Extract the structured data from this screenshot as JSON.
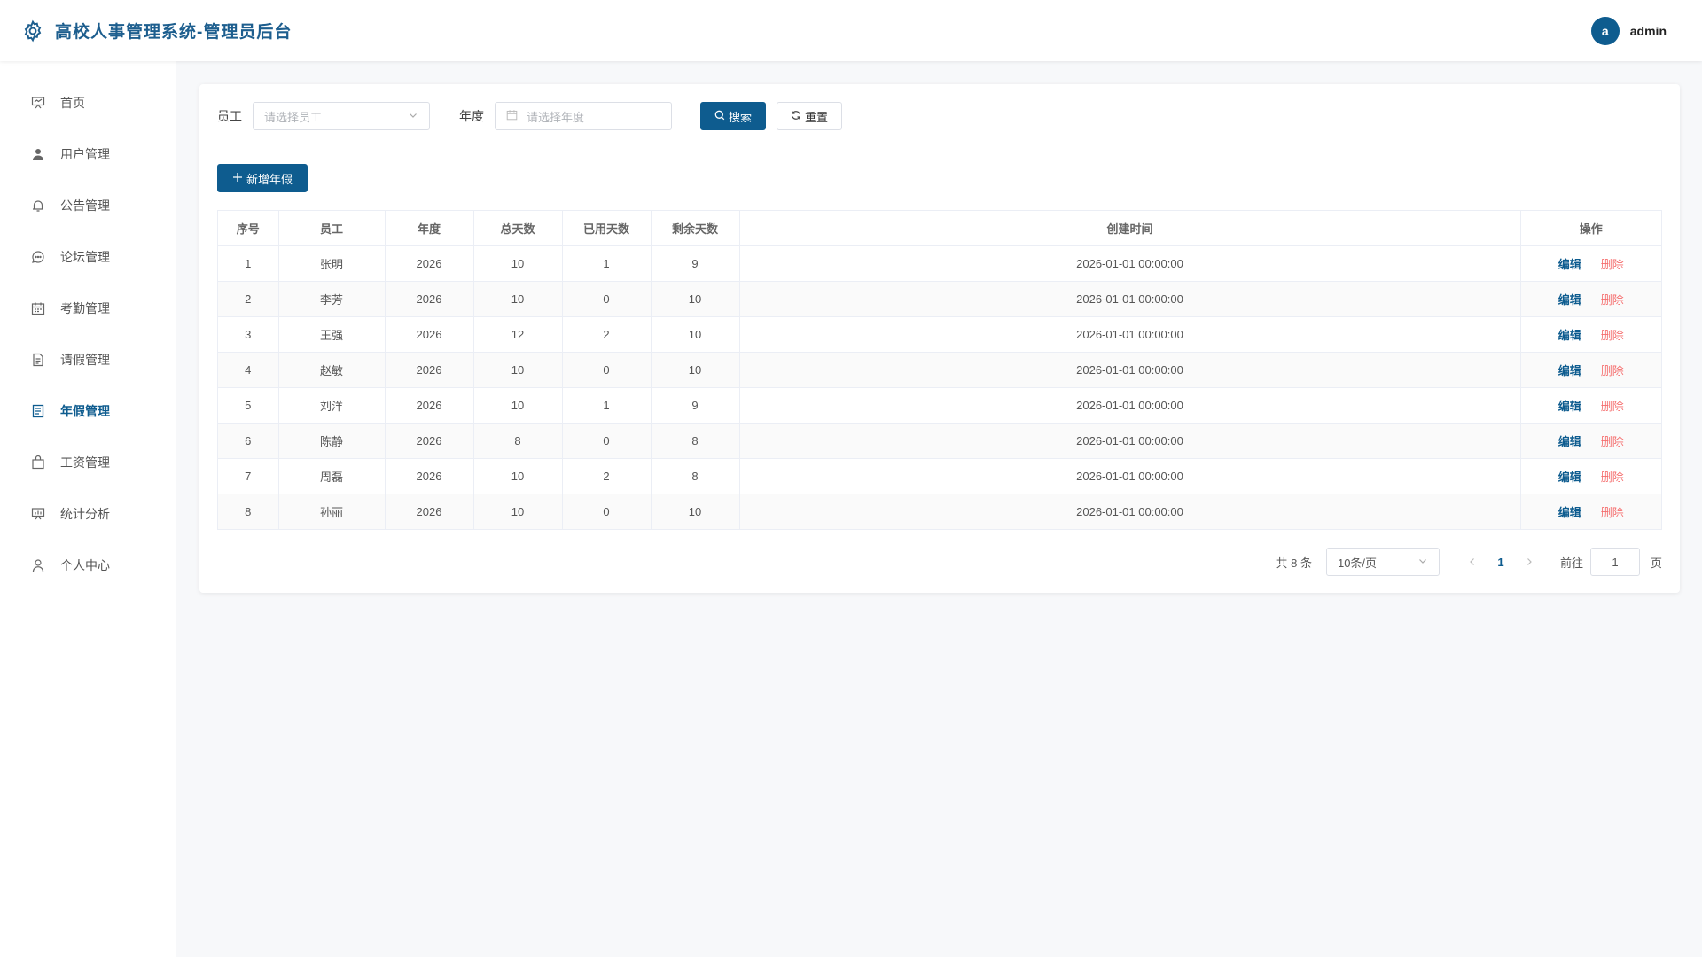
{
  "header": {
    "title": "高校人事管理系统-管理员后台",
    "logo_icon": "gear-icon",
    "user": {
      "avatar_letter": "a",
      "name": "admin"
    }
  },
  "sidebar": {
    "items": [
      {
        "label": "首页",
        "icon": "presentation-board-icon"
      },
      {
        "label": "用户管理",
        "icon": "user-icon"
      },
      {
        "label": "公告管理",
        "icon": "bell-icon"
      },
      {
        "label": "论坛管理",
        "icon": "chat-bubble-icon"
      },
      {
        "label": "考勤管理",
        "icon": "calendar-icon"
      },
      {
        "label": "请假管理",
        "icon": "document-icon"
      },
      {
        "label": "年假管理",
        "icon": "document-list-icon"
      },
      {
        "label": "工资管理",
        "icon": "briefcase-icon"
      },
      {
        "label": "统计分析",
        "icon": "chart-board-icon"
      },
      {
        "label": "个人中心",
        "icon": "user-outline-icon"
      }
    ],
    "active_index": 6
  },
  "filters": {
    "employee_label": "员工",
    "employee_placeholder": "请选择员工",
    "year_label": "年度",
    "year_placeholder": "请选择年度",
    "search_label": "搜索",
    "reset_label": "重置"
  },
  "toolbar": {
    "add_label": "新增年假"
  },
  "table": {
    "columns": [
      "序号",
      "员工",
      "年度",
      "总天数",
      "已用天数",
      "剩余天数",
      "创建时间",
      "操作"
    ],
    "rows": [
      [
        "1",
        "张明",
        "2026",
        "10",
        "1",
        "9",
        "2026-01-01 00:00:00"
      ],
      [
        "2",
        "李芳",
        "2026",
        "10",
        "0",
        "10",
        "2026-01-01 00:00:00"
      ],
      [
        "3",
        "王强",
        "2026",
        "12",
        "2",
        "10",
        "2026-01-01 00:00:00"
      ],
      [
        "4",
        "赵敏",
        "2026",
        "10",
        "0",
        "10",
        "2026-01-01 00:00:00"
      ],
      [
        "5",
        "刘洋",
        "2026",
        "10",
        "1",
        "9",
        "2026-01-01 00:00:00"
      ],
      [
        "6",
        "陈静",
        "2026",
        "8",
        "0",
        "8",
        "2026-01-01 00:00:00"
      ],
      [
        "7",
        "周磊",
        "2026",
        "10",
        "2",
        "8",
        "2026-01-01 00:00:00"
      ],
      [
        "8",
        "孙丽",
        "2026",
        "10",
        "0",
        "10",
        "2026-01-01 00:00:00"
      ]
    ],
    "edit_label": "编辑",
    "delete_label": "删除"
  },
  "pagination": {
    "total_text": "共 8 条",
    "page_size": "10条/页",
    "current_page": "1",
    "jump_label": "前往",
    "jump_value": "1",
    "jump_suffix": "页"
  },
  "colors": {
    "primary": "#0e5c8f",
    "danger": "#f56c6c"
  }
}
